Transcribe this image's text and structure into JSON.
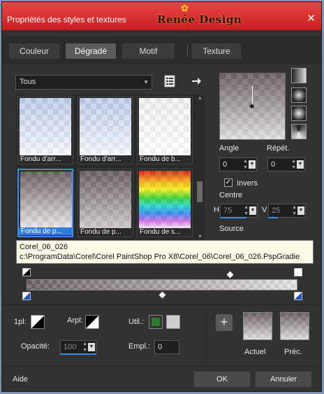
{
  "window": {
    "title": "Propriétés des styles et textures",
    "logo_text": "Renée Design",
    "close_glyph": "✕"
  },
  "tabs": [
    {
      "label": "Couleur",
      "active": false
    },
    {
      "label": "Dégradé",
      "active": true
    },
    {
      "label": "Motif",
      "active": false
    },
    {
      "label": "Texture",
      "active": false
    }
  ],
  "library": {
    "category_value": "Tous",
    "icons": {
      "manage": "document-list-icon",
      "next": "arrow-right-icon"
    },
    "thumbnails": [
      {
        "label": "Fondu d'arr...",
        "style": "blue-to-white",
        "selected": false
      },
      {
        "label": "Fondu d'arr...",
        "style": "blue-to-white",
        "selected": false
      },
      {
        "label": "Fondu de b...",
        "style": "white",
        "selected": false
      },
      {
        "label": "Fondu de p...",
        "style": "taupe-to-white",
        "selected": true
      },
      {
        "label": "Fondu de p...",
        "style": "taupe-to-gray",
        "selected": false
      },
      {
        "label": "Fondu de s...",
        "style": "spectrum",
        "selected": false
      }
    ]
  },
  "controls": {
    "angle_label": "Angle",
    "angle_value": "0",
    "repeat_label": "Répét.",
    "repeat_value": "0",
    "invert_label": "Invers",
    "invert_checked": true,
    "center_label": "Centre",
    "h_label": "H",
    "h_value": "75",
    "v_label": "V",
    "v_value": "25",
    "source_label": "Source"
  },
  "tooltip": {
    "name": "Corel_06_026",
    "path": "c:\\ProgramData\\Corel\\Corel PaintShop Pro X8\\Corel_06\\Corel_06_026.PspGradie"
  },
  "bottom": {
    "fpl_label": "1pl:",
    "arpl_label": "Arpl:",
    "util_label": "Util.:",
    "opacity_label": "Opacité:",
    "opacity_value": "100",
    "empl_label": "Empl.:",
    "empl_value": "0",
    "add_glyph": "+",
    "actual_label": "Actuel",
    "prev_label": "Préc.",
    "util_color": "#2f7d2f",
    "util_color2": "#cfcfcf"
  },
  "footer": {
    "help_label": "Aide",
    "ok_label": "OK",
    "cancel_label": "Annuler"
  },
  "colors": {
    "titlebar": "#d42a2a",
    "accent": "#3b8ee8",
    "panel": "#323232"
  }
}
